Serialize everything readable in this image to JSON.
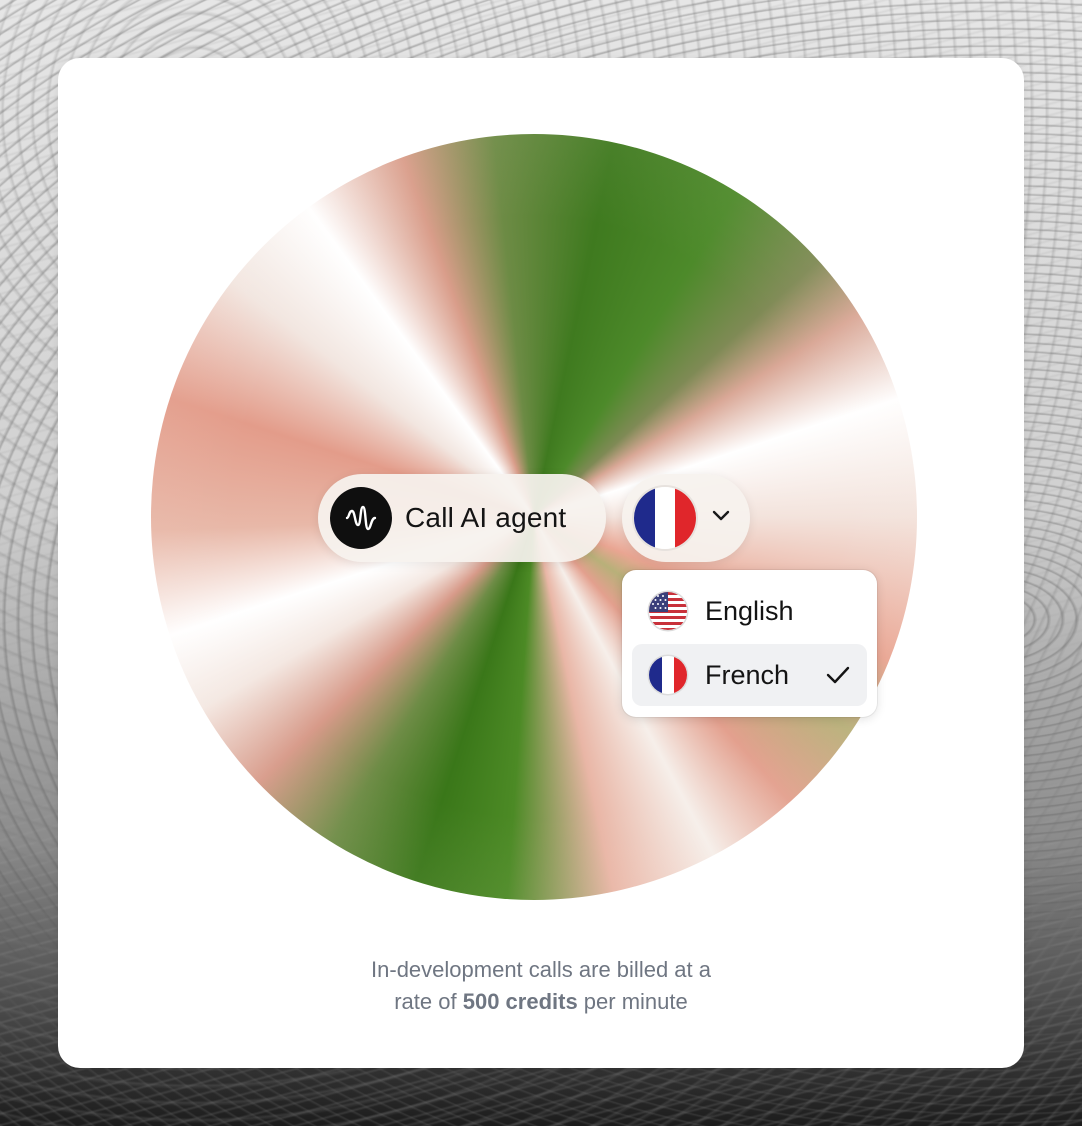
{
  "call_button": {
    "label": "Call AI agent",
    "icon": "soundwave-icon"
  },
  "language_selector": {
    "selected": "French",
    "icon": "chevron-down-icon",
    "options": [
      {
        "label": "English",
        "flag": "us-flag-icon",
        "selected": false
      },
      {
        "label": "French",
        "flag": "france-flag-icon",
        "selected": true
      }
    ],
    "check_icon": "check-icon"
  },
  "caption": {
    "line1": "In-development calls are billed at a",
    "line2_prefix": "rate of ",
    "line2_bold": "500 credits",
    "line2_suffix": " per minute"
  },
  "colors": {
    "card": "#ffffff",
    "text": "#141414",
    "muted": "#6f7682",
    "france_blue": "#1f2a8c",
    "france_red": "#e0262b",
    "us_red": "#c8313a",
    "us_blue": "#3a3f7a"
  }
}
